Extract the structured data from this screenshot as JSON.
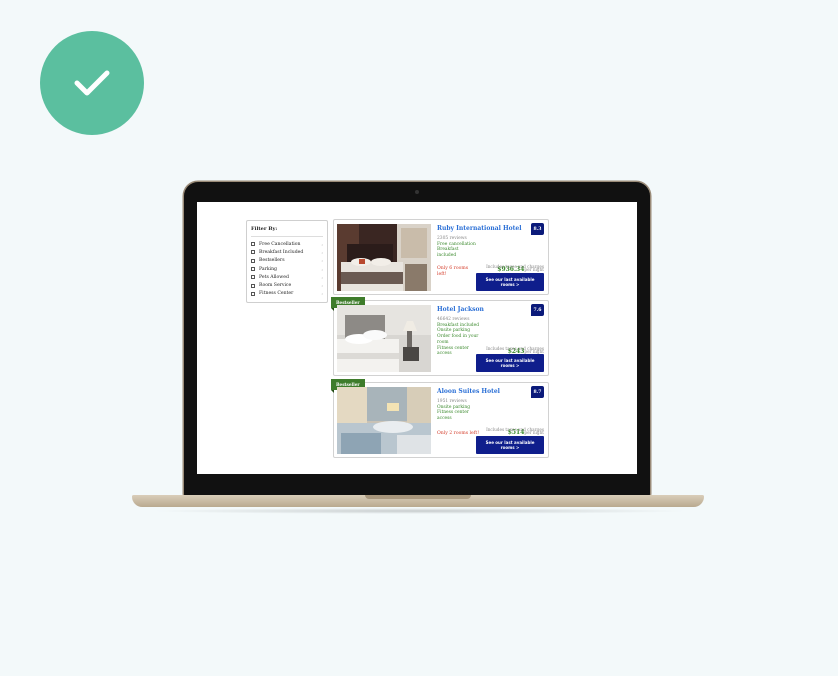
{
  "badge": {
    "icon": "check-icon",
    "color": "#5bbf9f"
  },
  "filters": {
    "title": "Filter By:",
    "items": [
      {
        "label": "Free Cancellation"
      },
      {
        "label": "Breakfast Included"
      },
      {
        "label": "Bestsellers"
      },
      {
        "label": "Parking"
      },
      {
        "label": "Pets Allowed"
      },
      {
        "label": "Room Service"
      },
      {
        "label": "Fitness Center"
      }
    ]
  },
  "hotels": [
    {
      "name": "Ruby International Hotel",
      "score": "8.3",
      "reviews": "2305 reviews",
      "features": [
        "Free cancellation",
        "Breakfast",
        "included"
      ],
      "scarcity": "Only 6 rooms left!",
      "price": "$936.34",
      "per_night": "per night",
      "taxes": "Includes taxes and charges",
      "cta": "See our last available rooms >",
      "ribbon": ""
    },
    {
      "name": "Hotel Jackson",
      "score": "7.6",
      "reviews": "46642 reviews",
      "features": [
        "Breakfast included",
        "Onsite parking",
        "Order food in your room",
        "Fitness center access"
      ],
      "scarcity": "",
      "price": "$243",
      "per_night": "per night",
      "taxes": "Includes taxes and charges",
      "cta": "See our last available rooms >",
      "ribbon": "Bestseller"
    },
    {
      "name": "Aloon Suites Hotel",
      "score": "8.7",
      "reviews": "1951 reviews",
      "features": [
        "Onsite parking",
        "Fitness center",
        "access"
      ],
      "scarcity": "Only 2 rooms left!",
      "price": "$514",
      "per_night": "per night",
      "taxes": "Includes taxes and charges",
      "cta": "See our last available rooms >",
      "ribbon": "Bestseller"
    }
  ]
}
